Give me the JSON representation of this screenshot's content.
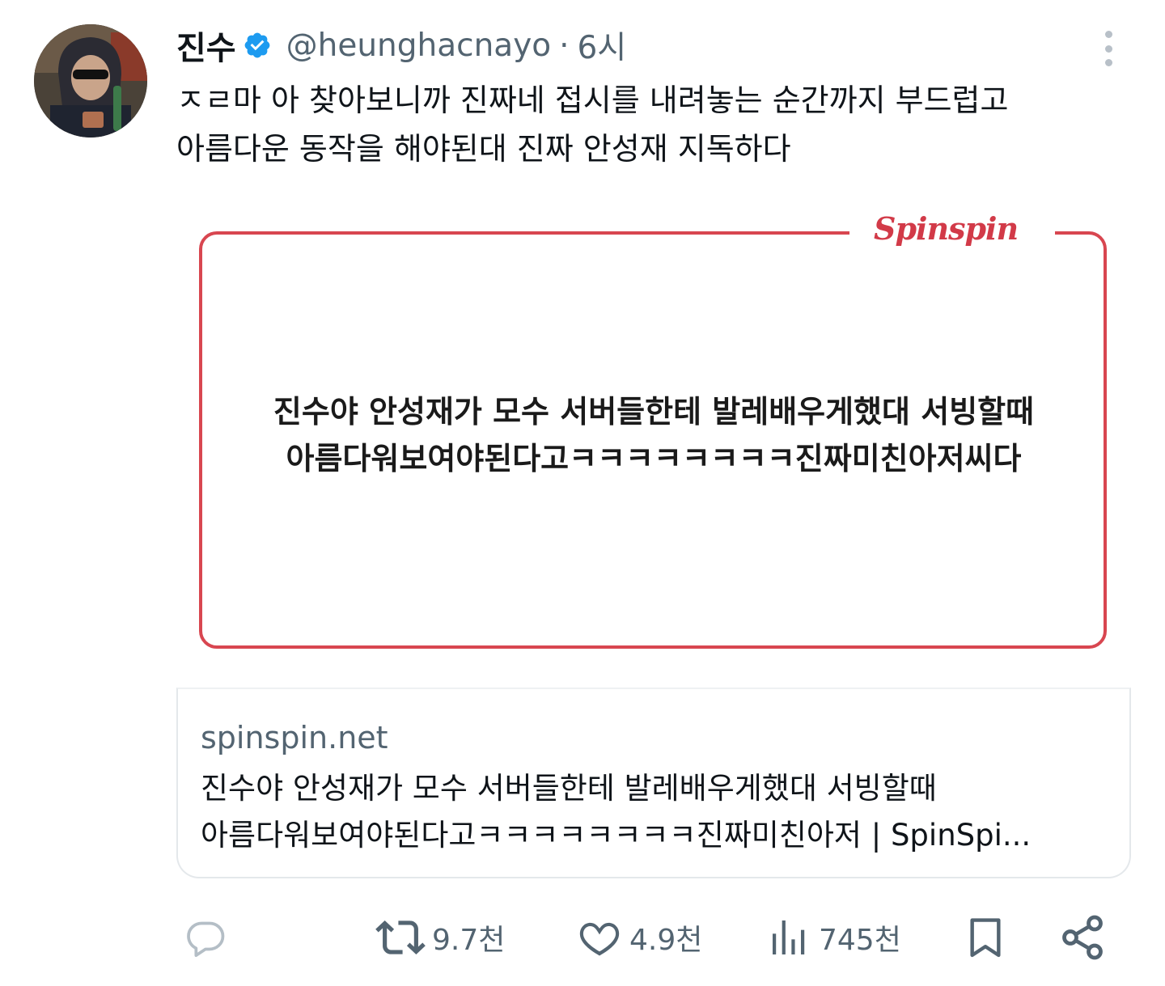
{
  "tweet": {
    "display_name": "진수",
    "handle": "@heunghacnayo",
    "separator": "·",
    "time": "6시",
    "text": "ㅈㄹ마 아 찾아보니까 진짜네 접시를 내려놓는 순간까지 부드럽고\n아름다운 동작을 해야된대 진짜 안성재 지독하다"
  },
  "media": {
    "brand": "Spinspin",
    "caption": "진수야 안성재가 모수 서버들한테 발레배우게했대 서빙할때\n아름다워보여야된다고ㅋㅋㅋㅋㅋㅋㅋㅋ진짜미친아저씨다"
  },
  "link_card": {
    "domain": "spinspin.net",
    "title": "진수야 안성재가 모수 서버들한테 발레배우게했대 서빙할때\n아름다워보여야된다고ㅋㅋㅋㅋㅋㅋㅋㅋ진짜미친아저 | SpinSpi..."
  },
  "actions": {
    "reply_icon": "reply-icon",
    "retweet_count": "9.7천",
    "like_count": "4.9천",
    "views_count": "745천",
    "bookmark_icon": "bookmark-icon",
    "share_icon": "share-icon"
  },
  "colors": {
    "text": "#0f1419",
    "secondary": "#536471",
    "verified": "#1d9bf0",
    "brand_red": "#d23a48",
    "border": "#e4e8eb"
  }
}
